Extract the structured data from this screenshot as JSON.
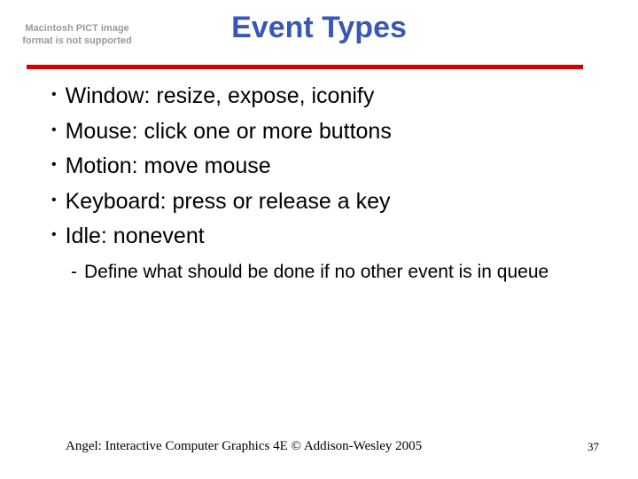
{
  "placeholder": "Macintosh PICT image format is not supported",
  "title": "Event Types",
  "bullets": [
    "Window: resize, expose, iconify",
    "Mouse: click one or more buttons",
    "Motion: move mouse",
    "Keyboard: press or release a key",
    "Idle: nonevent"
  ],
  "sub": "Define what should be done if no other event is in queue",
  "footer_left": "Angel: Interactive Computer Graphics 4E © Addison-Wesley 2005",
  "page_number": "37"
}
